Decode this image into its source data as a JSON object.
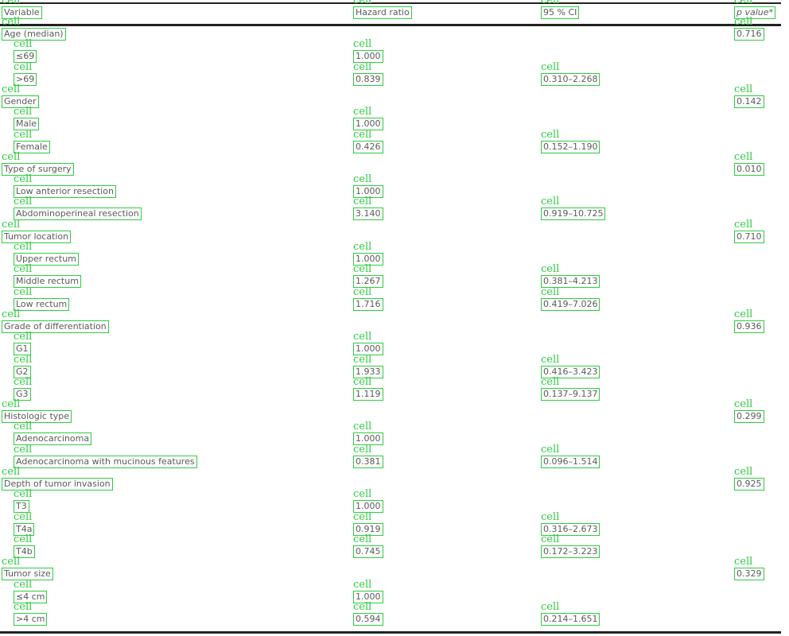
{
  "table": {
    "headers": [
      "Variable",
      "Hazard ratio",
      "95 % CI",
      "p value*"
    ],
    "cell_tag": "cell",
    "rows": [
      {
        "kind": "group",
        "label": "Age (median)",
        "hr": "",
        "ci": "",
        "p": "0.716"
      },
      {
        "kind": "sub",
        "label": "≤69",
        "hr": "1.000",
        "ci": "",
        "p": ""
      },
      {
        "kind": "sub",
        "label": ">69",
        "hr": "0.839",
        "ci": "0.310–2.268",
        "p": ""
      },
      {
        "kind": "group",
        "label": "Gender",
        "hr": "",
        "ci": "",
        "p": "0.142"
      },
      {
        "kind": "sub",
        "label": "Male",
        "hr": "1.000",
        "ci": "",
        "p": ""
      },
      {
        "kind": "sub",
        "label": "Female",
        "hr": "0.426",
        "ci": "0.152–1.190",
        "p": ""
      },
      {
        "kind": "group",
        "label": "Type of surgery",
        "hr": "",
        "ci": "",
        "p": "0.010"
      },
      {
        "kind": "sub",
        "label": "Low anterior resection",
        "hr": "1.000",
        "ci": "",
        "p": ""
      },
      {
        "kind": "sub",
        "label": "Abdominoperineal resection",
        "hr": "3.140",
        "ci": "0.919–10.725",
        "p": ""
      },
      {
        "kind": "group",
        "label": "Tumor location",
        "hr": "",
        "ci": "",
        "p": "0.710"
      },
      {
        "kind": "sub",
        "label": "Upper rectum",
        "hr": "1.000",
        "ci": "",
        "p": ""
      },
      {
        "kind": "sub",
        "label": "Middle rectum",
        "hr": "1.267",
        "ci": "0.381–4.213",
        "p": ""
      },
      {
        "kind": "sub",
        "label": "Low rectum",
        "hr": "1.716",
        "ci": "0.419–7.026",
        "p": ""
      },
      {
        "kind": "group",
        "label": "Grade of differentiation",
        "hr": "",
        "ci": "",
        "p": "0.936"
      },
      {
        "kind": "sub",
        "label": "G1",
        "hr": "1.000",
        "ci": "",
        "p": ""
      },
      {
        "kind": "sub",
        "label": "G2",
        "hr": "1.933",
        "ci": "0.416–3.423",
        "p": ""
      },
      {
        "kind": "sub",
        "label": "G3",
        "hr": "1.119",
        "ci": "0.137–9.137",
        "p": ""
      },
      {
        "kind": "group",
        "label": "Histologic type",
        "hr": "",
        "ci": "",
        "p": "0.299"
      },
      {
        "kind": "sub",
        "label": "Adenocarcinoma",
        "hr": "1.000",
        "ci": "",
        "p": ""
      },
      {
        "kind": "sub",
        "label": "Adenocarcinoma with mucinous features",
        "hr": "0.381",
        "ci": "0.096–1.514",
        "p": ""
      },
      {
        "kind": "group",
        "label": "Depth of tumor invasion",
        "hr": "",
        "ci": "",
        "p": "0.925"
      },
      {
        "kind": "sub",
        "label": "T3",
        "hr": "1.000",
        "ci": "",
        "p": ""
      },
      {
        "kind": "sub",
        "label": "T4a",
        "hr": "0.919",
        "ci": "0.316–2.673",
        "p": ""
      },
      {
        "kind": "sub",
        "label": "T4b",
        "hr": "0.745",
        "ci": "0.172–3.223",
        "p": ""
      },
      {
        "kind": "group",
        "label": "Tumor size",
        "hr": "",
        "ci": "",
        "p": "0.329"
      },
      {
        "kind": "sub",
        "label": "≤4 cm",
        "hr": "1.000",
        "ci": "",
        "p": ""
      },
      {
        "kind": "sub",
        "label": ">4 cm",
        "hr": "0.594",
        "ci": "0.214–1.651",
        "p": ""
      }
    ]
  }
}
